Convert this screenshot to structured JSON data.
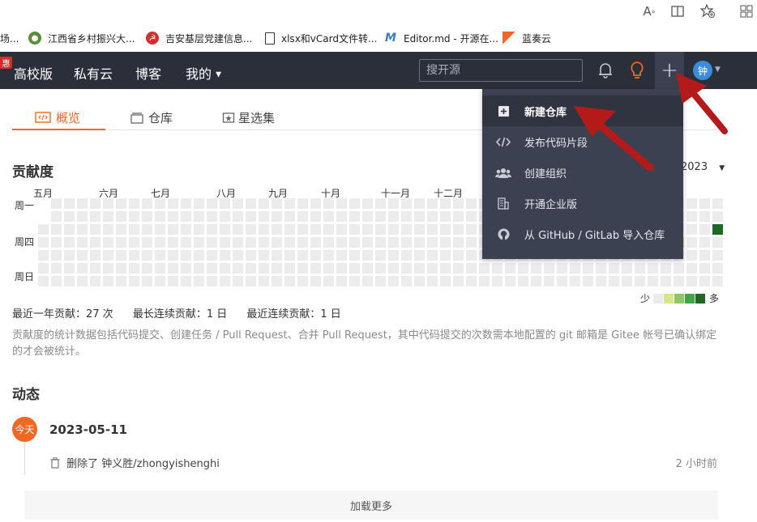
{
  "browser": {
    "bookmarks": [
      {
        "label": "场...",
        "icon": "page-icon",
        "color": "#888888"
      },
      {
        "label": "江西省乡村振兴大...",
        "icon": "globe-icon",
        "color": "#5a8f3a"
      },
      {
        "label": "吉安基层党建信息...",
        "icon": "party-emblem-icon",
        "color": "#d32f2f"
      },
      {
        "label": "xlsx和vCard文件转...",
        "icon": "document-icon",
        "color": "#333333"
      },
      {
        "label": "Editor.md - 开源在...",
        "icon": "markdown-m-icon",
        "color": "#3a7bd5"
      },
      {
        "label": "蓝奏云",
        "icon": "lanzou-flag-icon",
        "color": "#f26822"
      }
    ]
  },
  "nav": {
    "badge": "惠",
    "items": [
      "高校版",
      "私有云",
      "博客",
      "我的"
    ],
    "search_placeholder": "搜开源",
    "avatar_text": "钟",
    "accent": "#f26822"
  },
  "dropdown": {
    "items": [
      {
        "label": "新建仓库",
        "icon": "plus-square-icon"
      },
      {
        "label": "发布代码片段",
        "icon": "code-icon"
      },
      {
        "label": "创建组织",
        "icon": "group-icon"
      },
      {
        "label": "开通企业版",
        "icon": "building-icon"
      },
      {
        "label": "从 GitHub / GitLab 导入仓库",
        "icon": "github-icon"
      }
    ]
  },
  "tabs": [
    {
      "label": "概览",
      "icon": "overview-icon"
    },
    {
      "label": "仓库",
      "icon": "repo-icon"
    },
    {
      "label": "星选集",
      "icon": "star-collection-icon"
    }
  ],
  "contribution": {
    "title": "贡献度",
    "year": "2023",
    "months": [
      "五月",
      "六月",
      "七月",
      "八月",
      "九月",
      "十月",
      "十一月",
      "十二月"
    ],
    "weekdays": [
      "周一",
      "周四",
      "周日"
    ],
    "legend_less": "少",
    "legend_more": "多",
    "legend_colors": [
      "#ececec",
      "#d6e685",
      "#8cc665",
      "#44a340",
      "#1e6823"
    ],
    "stats": [
      "最近一年贡献：27 次",
      "最长连续贡献：1 日",
      "最近连续贡献：1 日"
    ],
    "note": "贡献度的统计数据包括代码提交、创建任务 / Pull Request、合并 Pull Request，其中代码提交的次数需本地配置的 git 邮箱是 Gitee 帐号已确认绑定的才会被统计。"
  },
  "activity": {
    "title": "动态",
    "today": "今天",
    "date": "2023-05-11",
    "entry_text": "删除了 钟义胜/zhongyishenghi",
    "entry_time": "2 小时前",
    "load_more": "加载更多"
  }
}
